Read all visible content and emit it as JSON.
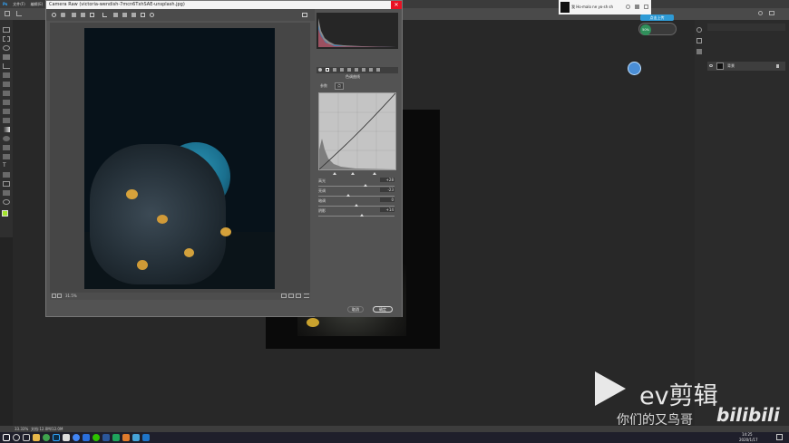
{
  "menubar": {
    "items": [
      "文件(F)",
      "编辑(E)"
    ]
  },
  "cameraraw": {
    "title": "Camera Raw (victoria-wendish-7mcn6TxhSAE-unsplash.jpg)",
    "panel_title": "色调曲线",
    "tabs": [
      "参数",
      "点"
    ],
    "sliders": [
      {
        "label": "高光",
        "value": "+28"
      },
      {
        "label": "亮调",
        "value": "-23"
      },
      {
        "label": "暗调",
        "value": "0"
      },
      {
        "label": "阴影",
        "value": "+14"
      }
    ],
    "zoom": "31.5%",
    "cancel": "取消",
    "ok": "确定"
  },
  "layers": {
    "layer_name": "背景"
  },
  "status": {
    "zoom": "33.33%",
    "doc": "文档:12.0M/12.0M"
  },
  "toast": {
    "text": "我 Ho·malo ne yo·sh sh"
  },
  "badge": {
    "text": "50%"
  },
  "float_btn": {
    "text": "点击上传"
  },
  "watermark": {
    "brand": "ev剪辑",
    "sub": "你们的又鸟哥",
    "bili": "bilibili"
  },
  "clock": {
    "time": "14:25",
    "date": "2020/1/17"
  },
  "colors": {
    "accent": "#2e9bd6",
    "close": "#e81123"
  }
}
